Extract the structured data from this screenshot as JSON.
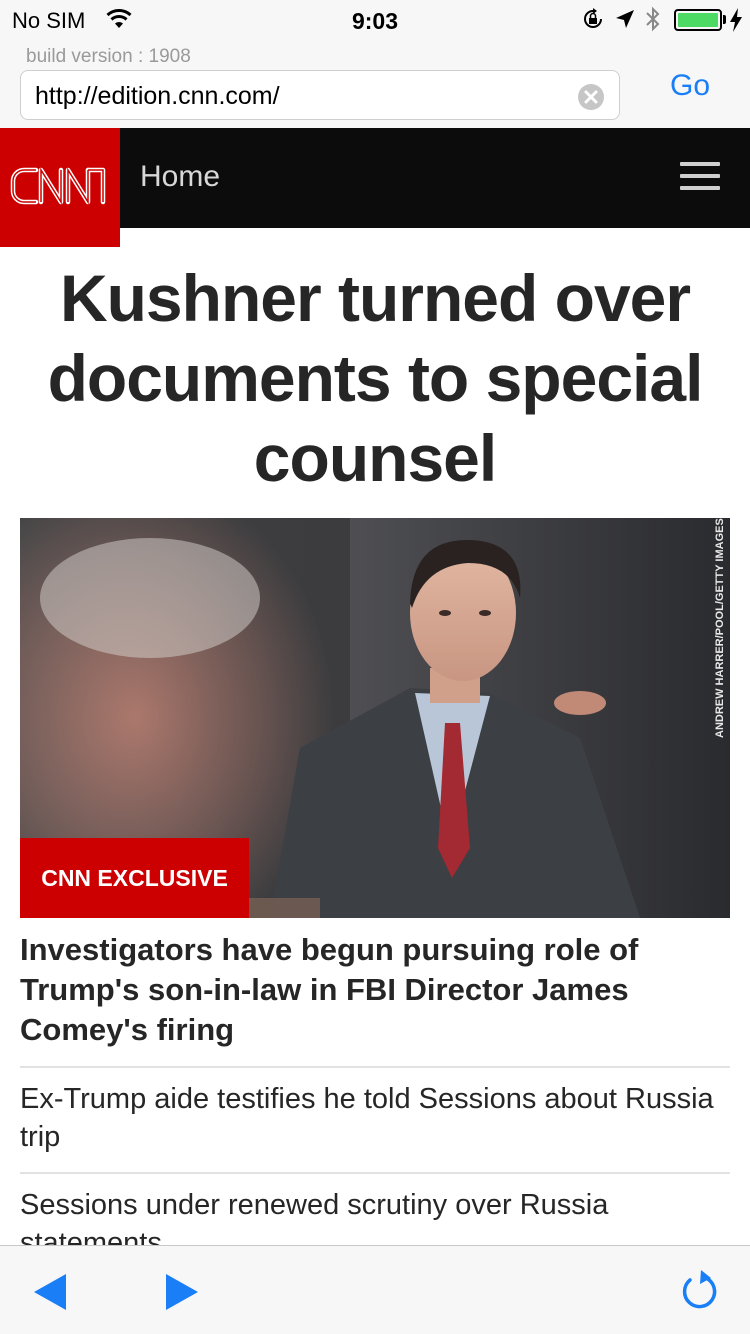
{
  "status_bar": {
    "carrier": "No SIM",
    "time": "9:03"
  },
  "browser": {
    "build_version": "build version : 1908",
    "url": "http://edition.cnn.com/",
    "go_label": "Go"
  },
  "site": {
    "logo_text": "CNN",
    "section": "Home",
    "brand_color": "#cc0000"
  },
  "article": {
    "headline": "Kushner turned over documents to special counsel",
    "photo_credit": "ANDREW HARRER/POOL/GETTY IMAGES",
    "badge": "CNN EXCLUSIVE",
    "lead_story": "Investigators have begun pursuing role of Trump's son-in-law in FBI Director James Comey's firing",
    "stories": [
      "Ex-Trump aide testifies he told Sessions about Russia trip",
      "Sessions under renewed scrutiny over Russia statements"
    ]
  },
  "toolbar": {
    "back_icon": "back-arrow-icon",
    "forward_icon": "forward-arrow-icon",
    "refresh_icon": "refresh-icon",
    "accent": "#1a7ef7"
  }
}
